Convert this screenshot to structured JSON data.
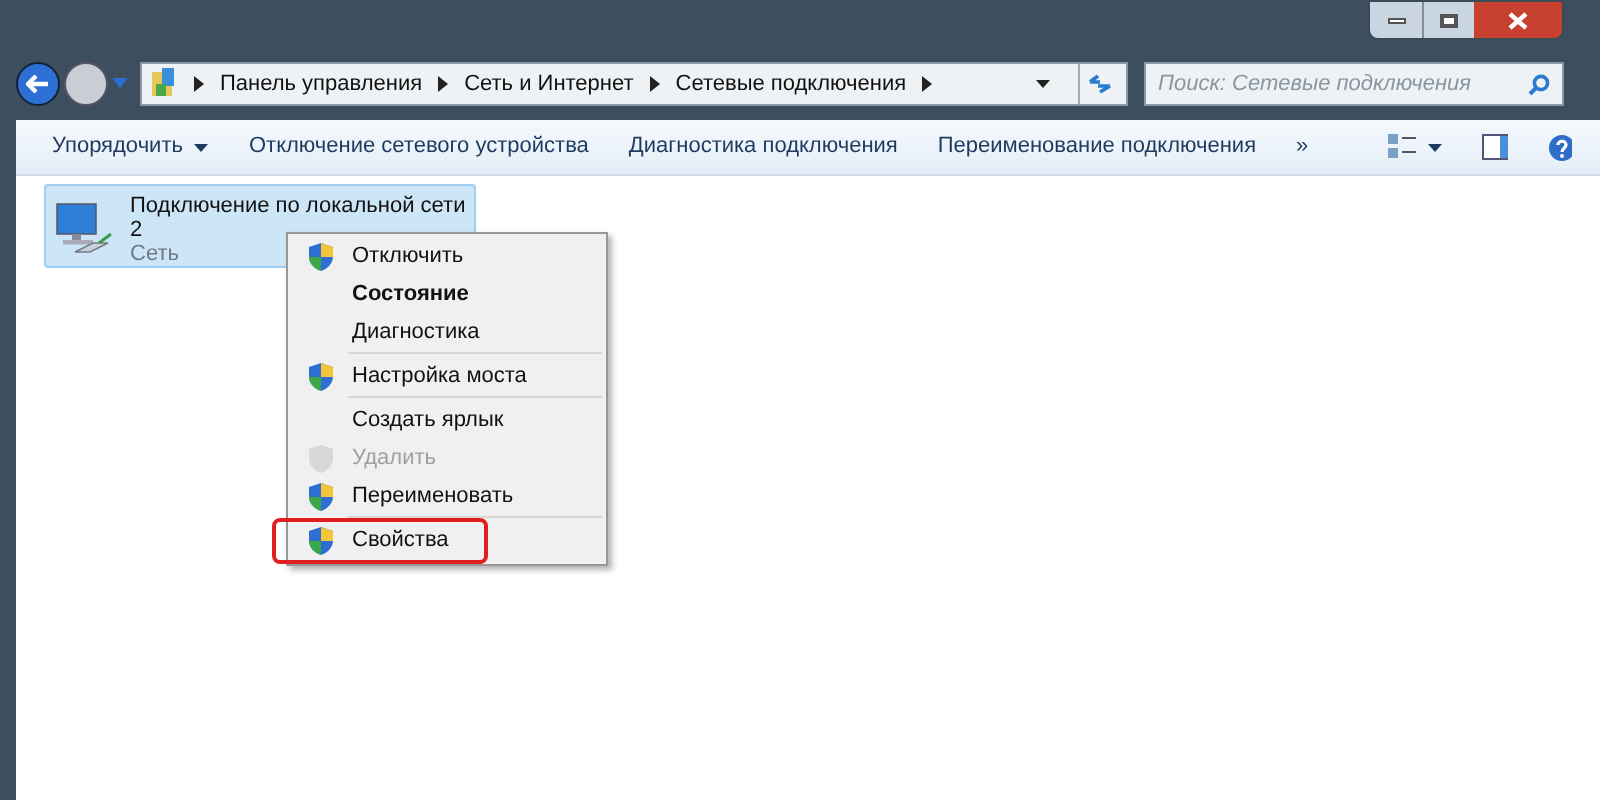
{
  "breadcrumb": [
    "Панель управления",
    "Сеть и Интернет",
    "Сетевые подключения"
  ],
  "search": {
    "placeholder": "Поиск: Сетевые подключения"
  },
  "toolbar": [
    {
      "label": "Упорядочить",
      "dropdown": true
    },
    {
      "label": "Отключение сетевого устройства",
      "dropdown": false
    },
    {
      "label": "Диагностика подключения",
      "dropdown": false
    },
    {
      "label": "Переименование подключения",
      "dropdown": false
    },
    {
      "label": "»",
      "dropdown": false
    }
  ],
  "connection": {
    "name": "Подключение по локальной сети 2",
    "status": "Сеть",
    "selected": true
  },
  "context_menu": [
    {
      "items": [
        {
          "label": "Отключить",
          "shield": true,
          "bold": false,
          "disabled": false,
          "highlighted": false
        },
        {
          "label": "Состояние",
          "shield": false,
          "bold": true,
          "disabled": false,
          "highlighted": false
        },
        {
          "label": "Диагностика",
          "shield": false,
          "bold": false,
          "disabled": false,
          "highlighted": false
        }
      ]
    },
    {
      "items": [
        {
          "label": "Настройка моста",
          "shield": true,
          "bold": false,
          "disabled": false,
          "highlighted": false
        }
      ]
    },
    {
      "items": [
        {
          "label": "Создать ярлык",
          "shield": false,
          "bold": false,
          "disabled": false,
          "highlighted": false
        },
        {
          "label": "Удалить",
          "shield": true,
          "bold": false,
          "disabled": true,
          "highlighted": false
        },
        {
          "label": "Переименовать",
          "shield": true,
          "bold": false,
          "disabled": false,
          "highlighted": false
        }
      ]
    },
    {
      "items": [
        {
          "label": "Свойства",
          "shield": true,
          "bold": false,
          "disabled": false,
          "highlighted": true
        }
      ]
    }
  ]
}
